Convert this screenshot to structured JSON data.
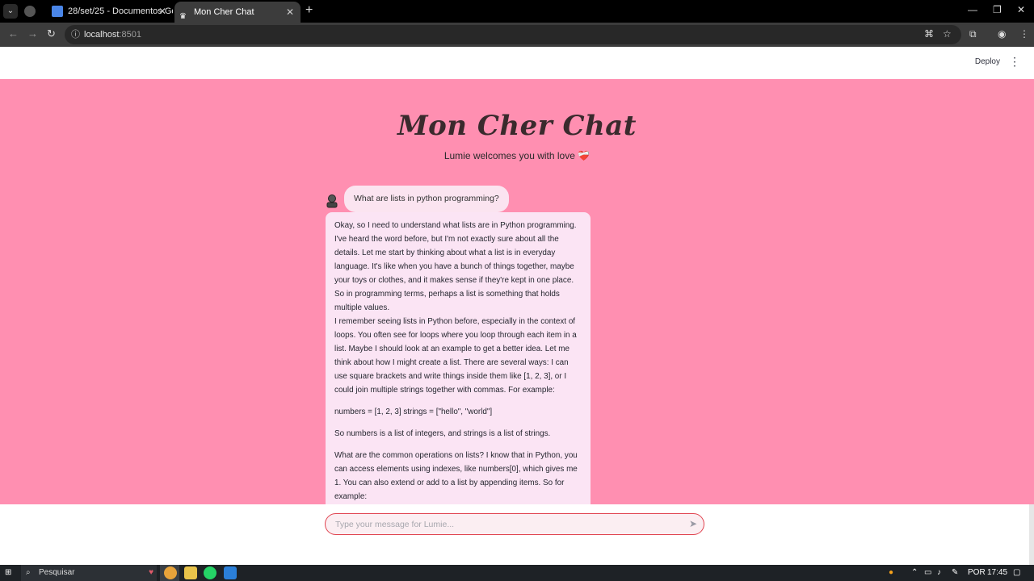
{
  "browser": {
    "tabs": [
      {
        "title": ""
      },
      {
        "title": "28/set/25 - Documentos Goog"
      },
      {
        "title": "Mon Cher Chat"
      }
    ],
    "url_host": "localhost",
    "url_port": ":8501"
  },
  "app_header": {
    "deploy_label": "Deploy"
  },
  "main": {
    "title": "Mon Cher Chat",
    "subtitle": "Lumie welcomes you with love",
    "heart_emoji": "❤️‍🩹"
  },
  "chat": {
    "user_message": "What are lists in python programming?",
    "assistant_paragraphs": [
      "Okay, so I need to understand what lists are in Python programming. I've heard the word before, but I'm not exactly sure about all the details. Let me start by thinking about what a list is in everyday language. It's like when you have a bunch of things together, maybe your toys or clothes, and it makes sense if they're kept in one place. So in programming terms, perhaps a list is something that holds multiple values.",
      "I remember seeing lists in Python before, especially in the context of loops. You often see for loops where you loop through each item in a list. Maybe I should look at an example to get a better idea. Let me think about how I might create a list. There are several ways: I can use square brackets and write things inside them like [1, 2, 3], or I could join multiple strings together with commas. For example:",
      "numbers = [1, 2, 3] strings = [\"hello\", \"world\"]",
      "So numbers is a list of integers, and strings is a list of strings.",
      "What are the common operations on lists? I know that in Python, you can access elements using indexes, like numbers[0], which gives me 1. You can also extend or add to a list by appending items. So for example:"
    ]
  },
  "input": {
    "placeholder": "Type your message for Lumie..."
  },
  "taskbar": {
    "search_label": "Pesquisar",
    "language": "POR",
    "time": "17:45"
  }
}
